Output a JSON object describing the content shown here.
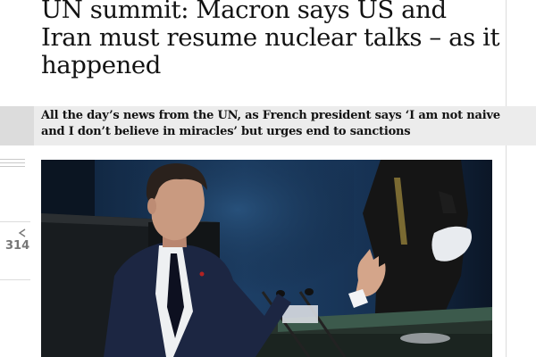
{
  "article": {
    "headline": "UN summit: Macron says US and Iran must resume nuclear talks – as it happened",
    "standfirst": "All the day’s news from the UN, as French president says ‘I am not naive and I don’t believe in miracles’ but urges end to sanctions"
  },
  "share": {
    "count": "314",
    "icon": "share-icon"
  },
  "photo": {
    "description_icon": "photo",
    "accent_colors": {
      "backdrop_blue": "#1d3f66",
      "suit_navy": "#1c2642",
      "skin": "#c99a80",
      "podium_green": "#3c5a4c"
    }
  },
  "colors": {
    "standfirst_band": "#ececec",
    "text": "#121212",
    "muted": "#767676",
    "rule": "#dcdcdc"
  }
}
